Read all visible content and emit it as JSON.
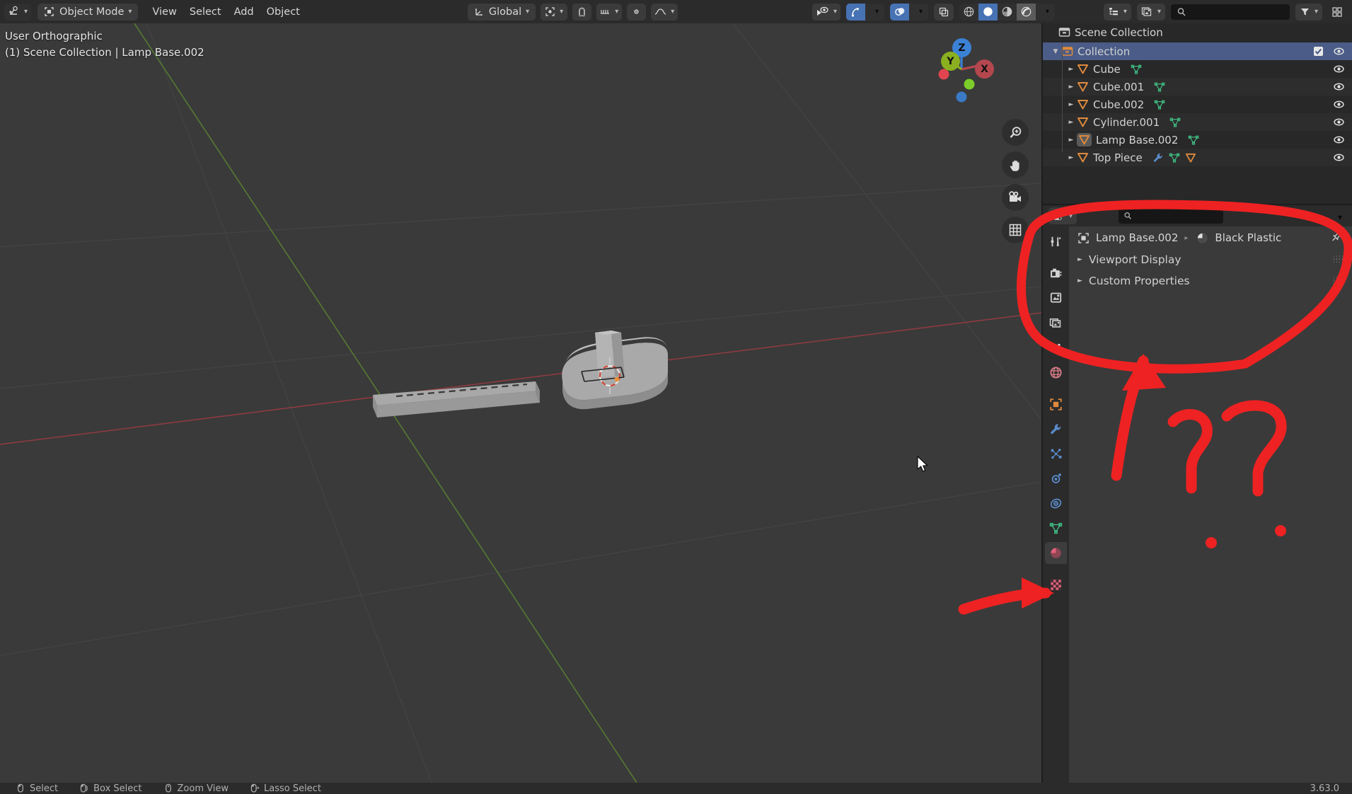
{
  "topbar": {
    "editor_type_icon": "editor-type-icon",
    "mode_icon": "object-mode-icon",
    "mode_label": "Object Mode",
    "menus": [
      "View",
      "Select",
      "Add",
      "Object"
    ],
    "transform_orientation_label": "Global",
    "transform_orientation_icon": "orientation-axes-icon",
    "pivot_icon": "pivot-point-icon",
    "snap_icon": "snap-magnet-icon",
    "snap_target_icon": "snap-increment-icon",
    "proportional_icon": "proportional-editing-icon",
    "proportional_falloff_icon": "falloff-curve-icon",
    "visibility_icon": "object-visibility-eye-icon",
    "gizmo_icon": "gizmo-arrow-icon",
    "overlays_icon": "overlays-circles-icon",
    "xray_icon": "xray-toggle-icon",
    "shading_wireframe_icon": "shading-wireframe-icon",
    "shading_solid_icon": "shading-solid-icon",
    "shading_material_icon": "shading-material-preview-icon",
    "shading_rendered_icon": "shading-rendered-icon",
    "outliner_display_icon": "outliner-filter-icon",
    "outliner_filter_icon": "filter-funnel-icon",
    "outliner_new_icon": "new-collection-icon",
    "outliner_search_icon": "search-icon"
  },
  "viewport": {
    "view_name": "User Orthographic",
    "scene_info": "(1) Scene Collection | Lamp Base.002",
    "gizmo": {
      "z_label": "Z",
      "y_label": "Y",
      "x_label": "X",
      "z_color": "#3b82d6",
      "y_color": "#8ab020",
      "x_color": "#b4474e",
      "neg_x_color": "#e1454f",
      "neg_y_color": "#7ccd2a",
      "neg_z_color": "#3a79c6"
    },
    "tools": [
      {
        "name": "zoom-view-icon"
      },
      {
        "name": "pan-view-icon"
      },
      {
        "name": "camera-view-icon"
      },
      {
        "name": "toggle-orthographic-icon"
      }
    ]
  },
  "outliner": {
    "scene_collection_label": "Scene Collection",
    "scene_collection_icon": "collection-box-icon",
    "rows": [
      {
        "label": "Collection",
        "icon": "collection-box-icon",
        "indent": 0,
        "selected": true,
        "expanded": true,
        "checkbox": true,
        "eye": true,
        "data_icons": []
      },
      {
        "label": "Cube",
        "icon": "mesh-object-icon",
        "indent": 1,
        "selected": false,
        "expanded": false,
        "checkbox": false,
        "eye": true,
        "data_icons": [
          "mesh-data-icon"
        ]
      },
      {
        "label": "Cube.001",
        "icon": "mesh-object-icon",
        "indent": 1,
        "selected": false,
        "expanded": false,
        "checkbox": false,
        "eye": true,
        "data_icons": [
          "mesh-data-icon"
        ]
      },
      {
        "label": "Cube.002",
        "icon": "mesh-object-icon",
        "indent": 1,
        "selected": false,
        "expanded": false,
        "checkbox": false,
        "eye": true,
        "data_icons": [
          "mesh-data-icon"
        ]
      },
      {
        "label": "Cylinder.001",
        "icon": "mesh-object-icon",
        "indent": 1,
        "selected": false,
        "expanded": false,
        "checkbox": false,
        "eye": true,
        "data_icons": [
          "mesh-data-icon"
        ]
      },
      {
        "label": "Lamp Base.002",
        "icon": "mesh-object-icon",
        "indent": 1,
        "selected": false,
        "active": true,
        "expanded": false,
        "checkbox": false,
        "eye": true,
        "data_icons": [
          "mesh-data-icon"
        ]
      },
      {
        "label": "Top Piece",
        "icon": "mesh-object-icon",
        "indent": 1,
        "selected": false,
        "expanded": false,
        "checkbox": false,
        "eye": true,
        "data_icons": [
          "modifier-wrench-icon",
          "mesh-data-icon",
          "mesh-object-icon"
        ]
      }
    ]
  },
  "properties": {
    "editor_icon": "properties-editor-icon",
    "search_placeholder": "",
    "search_icon": "search-icon",
    "options_chevron_icon": "chevron-down-icon",
    "breadcrumb": {
      "object_icon": "object-properties-icon",
      "object_name": "Lamp Base.002",
      "separator": "▸",
      "material_icon": "material-sphere-icon",
      "material_name": "Black Plastic",
      "pin_icon": "pin-icon"
    },
    "panels": [
      {
        "label": "Viewport Display",
        "expanded": false
      },
      {
        "label": "Custom Properties",
        "expanded": false
      }
    ],
    "tabs": [
      {
        "name": "tool-tab",
        "icon": "tool-screwdriver-wrench-icon",
        "active": false,
        "color": "#d0d0d0"
      },
      {
        "name": "render-tab",
        "icon": "render-camera-back-icon",
        "active": false,
        "color": "#d0d0d0",
        "gap": true
      },
      {
        "name": "output-tab",
        "icon": "output-printer-icon",
        "active": false,
        "color": "#d0d0d0"
      },
      {
        "name": "view-layer-tab",
        "icon": "view-layer-images-icon",
        "active": false,
        "color": "#d0d0d0"
      },
      {
        "name": "scene-tab",
        "icon": "scene-cone-sphere-icon",
        "active": false,
        "color": "#d0d0d0"
      },
      {
        "name": "world-tab",
        "icon": "world-globe-icon",
        "active": false,
        "color": "#d47b86"
      },
      {
        "name": "object-tab",
        "icon": "object-square-icon",
        "active": false,
        "color": "#e08a3c",
        "gap": true
      },
      {
        "name": "modifiers-tab",
        "icon": "modifier-wrench-icon",
        "active": false,
        "color": "#5a8ccc"
      },
      {
        "name": "particles-tab",
        "icon": "particles-icon",
        "active": false,
        "color": "#5a8ccc"
      },
      {
        "name": "physics-tab",
        "icon": "physics-orbit-icon",
        "active": false,
        "color": "#5a8ccc"
      },
      {
        "name": "object-constraints-tab",
        "icon": "constraints-clamp-icon",
        "active": false,
        "color": "#5a8ccc"
      },
      {
        "name": "object-data-tab",
        "icon": "mesh-data-icon",
        "active": false,
        "color": "#3fb87f"
      },
      {
        "name": "material-tab",
        "icon": "material-sphere-icon",
        "active": true,
        "color": "#e0607a"
      },
      {
        "name": "texture-tab",
        "icon": "texture-checker-icon",
        "active": false,
        "color": "#e0607a",
        "gap": true
      }
    ]
  },
  "status_bar": {
    "items": [
      {
        "icon": "mouse-left-icon",
        "label": "Select"
      },
      {
        "icon": "mouse-left-drag-icon",
        "label": "Box Select"
      },
      {
        "icon": "mouse-middle-icon",
        "label": "Zoom View"
      },
      {
        "icon": "mouse-left-ctrl-icon",
        "label": "Lasso Select"
      }
    ],
    "version": "3.63.0"
  },
  "annotations": {
    "ellipse_color": "#ee2222",
    "arrow_color": "#ee2222",
    "question_marks": [
      "?",
      "?"
    ],
    "note": "red hand-drawn ellipse around properties breadcrumb, arrow pointing up into it, two question marks, arrow pointing at material tab"
  },
  "colors": {
    "viewport_bg": "#3a3a3a",
    "header_bg": "#2b2b2b",
    "panel_bg": "#303030",
    "outliner_bg": "#282828",
    "selection_blue": "#4a5c87",
    "accent_blue": "#4772b3",
    "text": "#d6d6d6"
  }
}
